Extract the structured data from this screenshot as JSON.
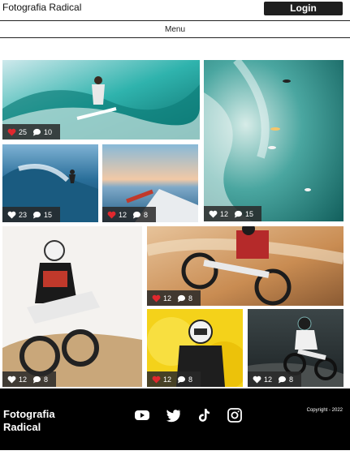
{
  "header": {
    "brand": "Fotografia Radical",
    "login_label": "Login"
  },
  "menu": {
    "label": "Menu"
  },
  "gallery": [
    {
      "likes": "25",
      "comments": "10",
      "heart_color": "#e0282e"
    },
    {
      "likes": "12",
      "comments": "15",
      "heart_color": "#ffffff"
    },
    {
      "likes": "23",
      "comments": "15",
      "heart_color": "#ffffff"
    },
    {
      "likes": "12",
      "comments": "8",
      "heart_color": "#e0282e"
    },
    {
      "likes": "12",
      "comments": "8",
      "heart_color": "#ffffff"
    },
    {
      "likes": "12",
      "comments": "8",
      "heart_color": "#e0282e"
    },
    {
      "likes": "12",
      "comments": "8",
      "heart_color": "#e0282e"
    },
    {
      "likes": "12",
      "comments": "8",
      "heart_color": "#ffffff"
    }
  ],
  "footer": {
    "brand": "Fotografia Radical",
    "socials": [
      "youtube-icon",
      "twitter-icon",
      "tiktok-icon",
      "instagram-icon"
    ],
    "copyright": "Copyright - 2022"
  }
}
